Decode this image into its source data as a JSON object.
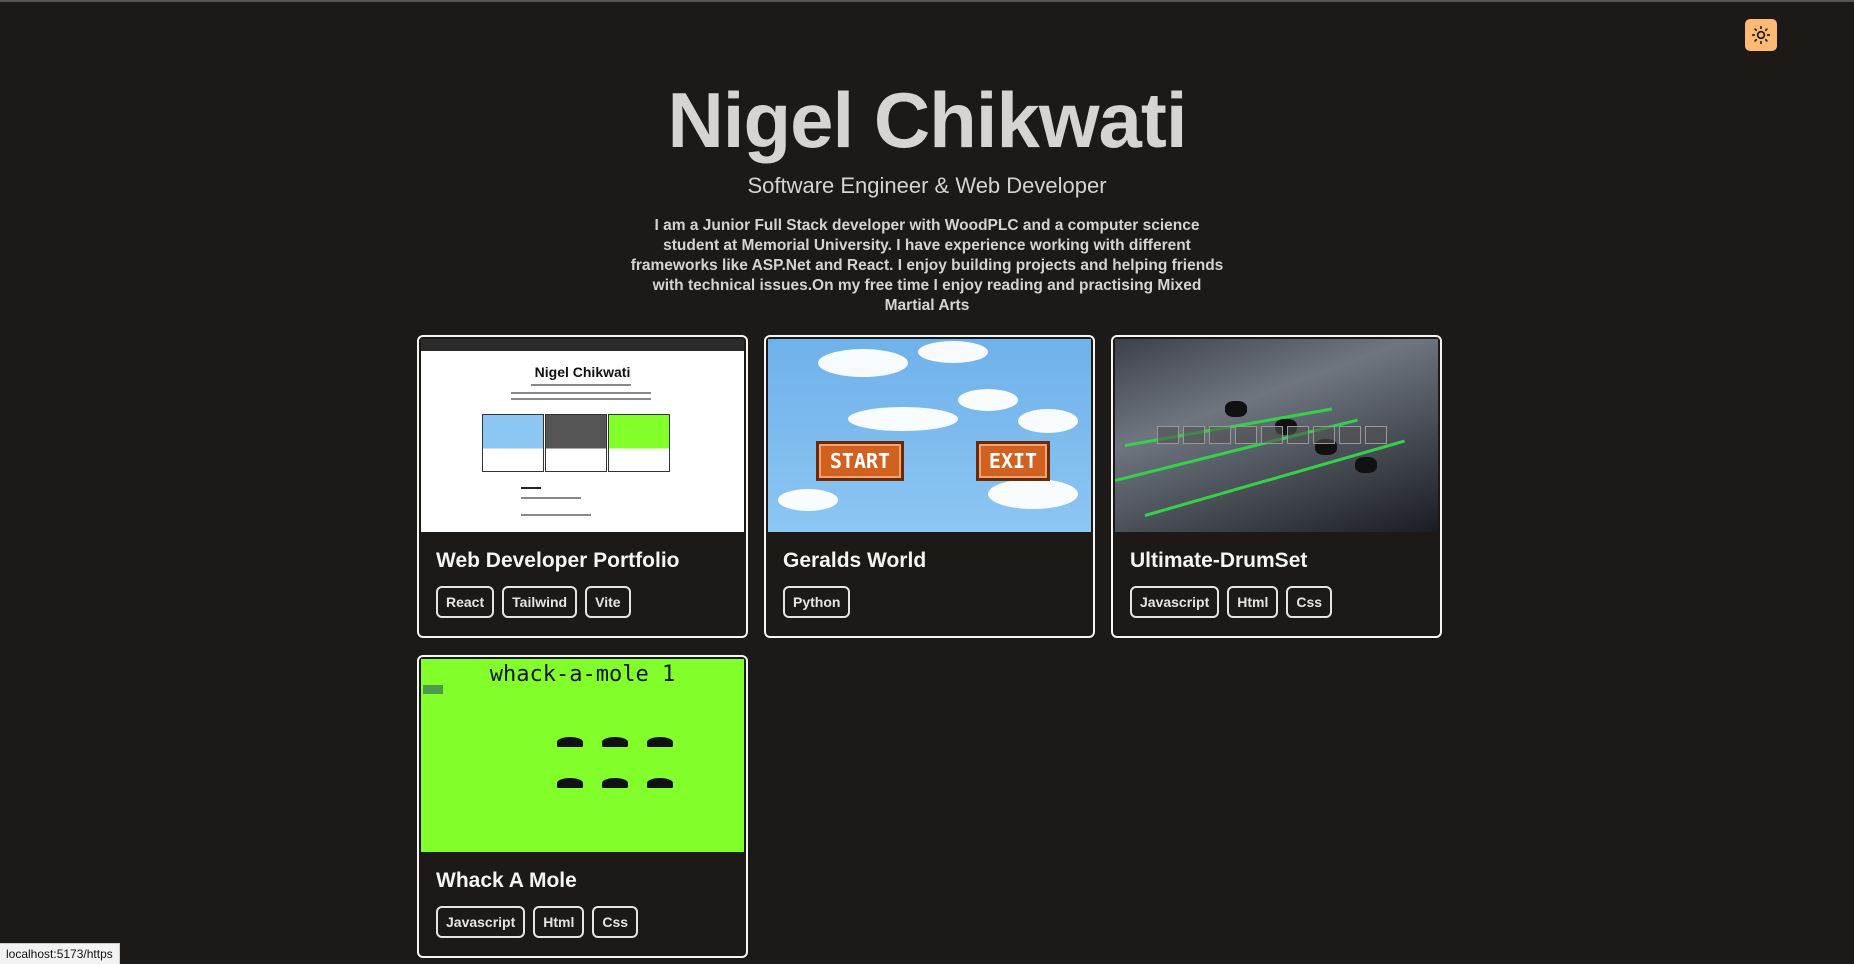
{
  "header": {
    "name": "Nigel Chikwati",
    "subtitle": "Software Engineer & Web Developer",
    "bio": "I am a Junior Full Stack developer with WoodPLC and a computer science student at Memorial University. I have experience working with different frameworks like ASP.Net and React. I enjoy building projects and helping friends with technical issues.On my free time I enjoy reading and practising Mixed Martial Arts",
    "theme_toggle_icon": "sun-icon"
  },
  "projects": [
    {
      "title": "Web Developer Portfolio",
      "tags": [
        "React",
        "Tailwind",
        "Vite"
      ],
      "thumbnail": {
        "mini_title": "Nigel Chikwati"
      }
    },
    {
      "title": "Geralds World",
      "tags": [
        "Python"
      ],
      "thumbnail": {
        "start_label": "START",
        "exit_label": "EXIT"
      }
    },
    {
      "title": "Ultimate-DrumSet",
      "tags": [
        "Javascript",
        "Html",
        "Css"
      ]
    },
    {
      "title": "Whack A Mole",
      "tags": [
        "Javascript",
        "Html",
        "Css"
      ],
      "thumbnail": {
        "game_title": "whack-a-mole  1"
      }
    }
  ],
  "status_bar": {
    "url": "localhost:5173/https"
  },
  "colors": {
    "background": "#1c1917",
    "accent": "#fdba74",
    "card_border": "#f5f5f4"
  }
}
